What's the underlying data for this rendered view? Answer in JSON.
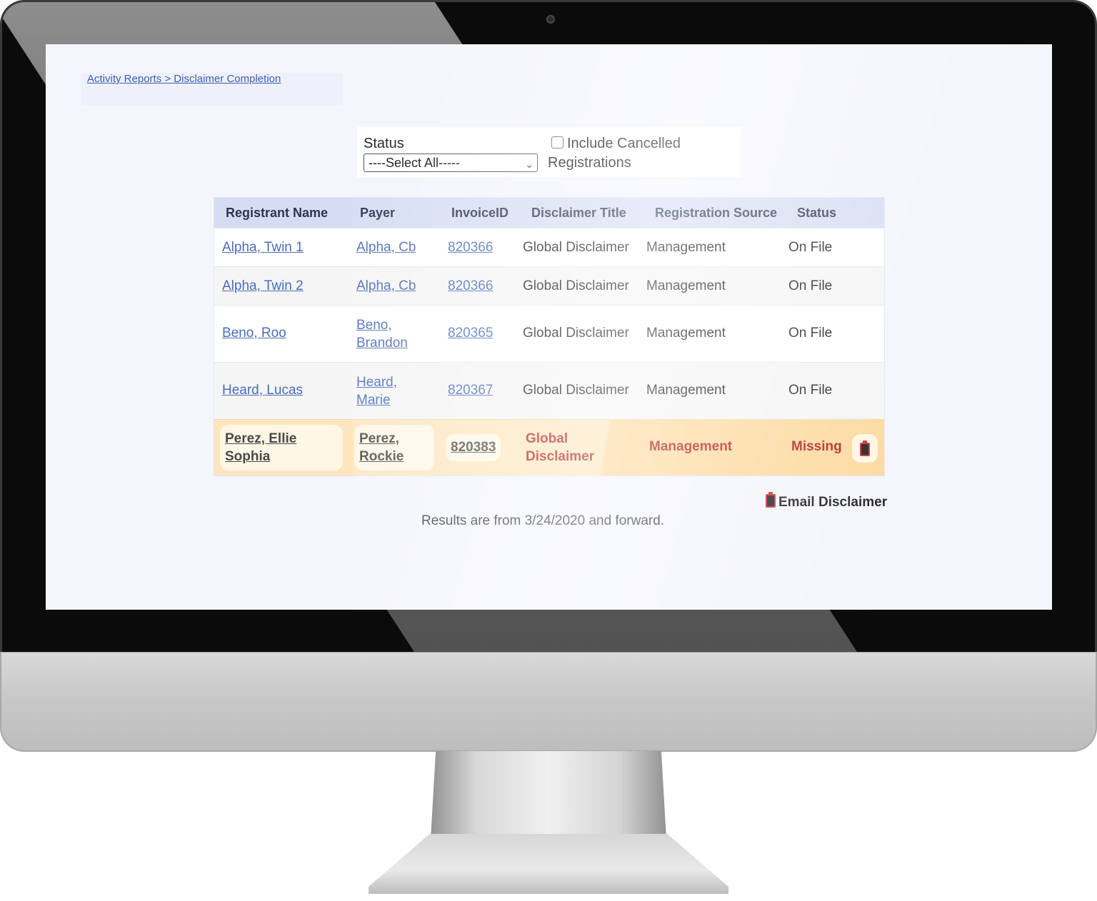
{
  "breadcrumb": "Activity Reports > Disclaimer Completion",
  "filters": {
    "status_label": "Status",
    "status_selected": "----Select All-----",
    "include_cancelled_line1": "Include Cancelled",
    "include_cancelled_line2": "Registrations",
    "include_cancelled_checked": false
  },
  "table": {
    "headers": [
      "Registrant Name",
      "Payer",
      "InvoiceID",
      "Disclaimer Title",
      "Registration Source",
      "Status"
    ],
    "rows": [
      {
        "registrant": "Alpha, Twin 1",
        "payer": "Alpha, Cb",
        "invoice": "820366",
        "title": "Global Disclaimer",
        "source": "Management",
        "status": "On File"
      },
      {
        "registrant": "Alpha, Twin 2",
        "payer": "Alpha, Cb",
        "invoice": "820366",
        "title": "Global Disclaimer",
        "source": "Management",
        "status": "On File"
      },
      {
        "registrant": "Beno, Roo",
        "payer_line1": "Beno,",
        "payer_line2": "Brandon",
        "invoice": "820365",
        "title": "Global Disclaimer",
        "source": "Management",
        "status": "On File"
      },
      {
        "registrant": "Heard, Lucas",
        "payer_line1": "Heard,",
        "payer_line2": "Marie",
        "invoice": "820367",
        "title": "Global Disclaimer",
        "source": "Management",
        "status": "On File"
      },
      {
        "registrant_line1": "Perez, Ellie",
        "registrant_line2": "Sophia",
        "payer_line1": "Perez,",
        "payer_line2": "Rockie",
        "invoice": "820383",
        "title_line1": "Global",
        "title_line2": "Disclaimer",
        "source": "Management",
        "status": "Missing"
      }
    ]
  },
  "legend_label": "Email Disclaimer",
  "results_note": "Results are from 3/24/2020 and forward.",
  "colors": {
    "header_bg": "#d6ddf3",
    "link": "#4a6db8",
    "missing_row": "#fde6bd",
    "missing_text": "#b11c1c"
  },
  "icons": {
    "email_disclaimer": "clipboard-icon",
    "select_arrow": "chevron-down-icon"
  }
}
